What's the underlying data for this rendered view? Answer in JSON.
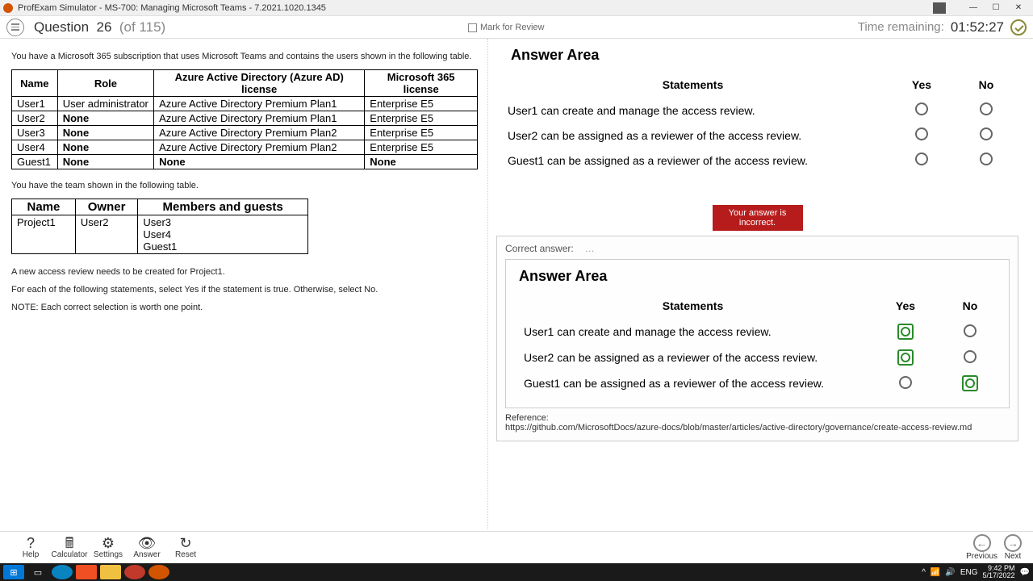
{
  "window": {
    "title": "ProfExam Simulator - MS-700: Managing Microsoft Teams - 7.2021.1020.1345"
  },
  "header": {
    "question_label": "Question",
    "question_num": "26",
    "question_of": "(of 115)",
    "mark_review": "Mark for Review",
    "time_label": "Time remaining:",
    "time_value": "01:52:27"
  },
  "question": {
    "intro": "You have a Microsoft 365 subscription that uses Microsoft Teams and contains the users shown in the following table.",
    "users_table": {
      "headers": [
        "Name",
        "Role",
        "Azure Active Directory (Azure AD) license",
        "Microsoft 365 license"
      ],
      "rows": [
        [
          "User1",
          "User administrator",
          "Azure Active Directory Premium Plan1",
          "Enterprise E5"
        ],
        [
          "User2",
          "None",
          "Azure Active Directory Premium Plan1",
          "Enterprise E5"
        ],
        [
          "User3",
          "None",
          "Azure Active Directory Premium Plan2",
          "Enterprise E5"
        ],
        [
          "User4",
          "None",
          "Azure Active Directory Premium Plan2",
          "Enterprise E5"
        ],
        [
          "Guest1",
          "None",
          "None",
          "None"
        ]
      ]
    },
    "team_intro": "You have the team shown in the following table.",
    "team_table": {
      "headers": [
        "Name",
        "Owner",
        "Members and guests"
      ],
      "rows": [
        [
          "Project1",
          "User2",
          "User3\nUser4\nGuest1"
        ]
      ]
    },
    "p1": "A new access review needs to be created for Project1.",
    "p2": "For each of the following statements, select Yes if the statement is true. Otherwise, select No.",
    "p3": "NOTE: Each correct selection is worth one point."
  },
  "answer_area": {
    "title": "Answer Area",
    "col_statements": "Statements",
    "col_yes": "Yes",
    "col_no": "No",
    "statements": [
      "User1 can create and manage the access review.",
      "User2 can be assigned as a reviewer of the access review.",
      "Guest1 can be assigned as a reviewer of the access review."
    ]
  },
  "feedback": {
    "incorrect": "Your answer is incorrect.",
    "correct_label": "Correct answer:",
    "reference_label": "Reference:",
    "reference_url": "https://github.com/MicrosoftDocs/azure-docs/blob/master/articles/active-directory/governance/create-access-review.md"
  },
  "bottom": {
    "help": "Help",
    "calc": "Calculator",
    "settings": "Settings",
    "answer": "Answer",
    "reset": "Reset",
    "prev": "Previous",
    "next": "Next"
  },
  "taskbar": {
    "lang": "ENG",
    "time": "9:42 PM",
    "date": "5/17/2022"
  }
}
